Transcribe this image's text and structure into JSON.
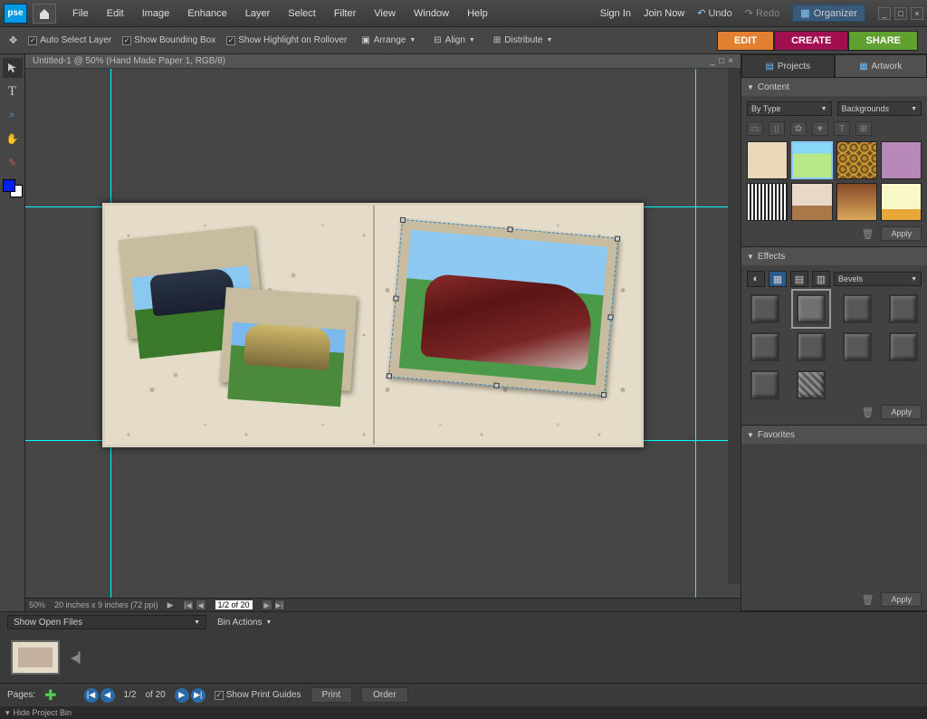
{
  "app": {
    "logo_text": "pse"
  },
  "menu": [
    "File",
    "Edit",
    "Image",
    "Enhance",
    "Layer",
    "Select",
    "Filter",
    "View",
    "Window",
    "Help"
  ],
  "top_right": {
    "sign_in": "Sign In",
    "join_now": "Join Now",
    "undo": "Undo",
    "redo": "Redo",
    "organizer": "Organizer"
  },
  "options": {
    "auto_select": "Auto Select Layer",
    "show_bbox": "Show Bounding Box",
    "show_highlight": "Show Highlight on Rollover",
    "arrange": "Arrange",
    "align": "Align",
    "distribute": "Distribute"
  },
  "modes": {
    "edit": "EDIT",
    "create": "CREATE",
    "share": "SHARE"
  },
  "doc": {
    "title": "Untitled-1 @ 50% (Hand Made Paper 1, RGB/8)",
    "zoom": "50%",
    "dims": "20 inches x 9 inches (72 ppi)",
    "page_indicator": "1/2 of 20"
  },
  "right": {
    "tab_projects": "Projects",
    "tab_artwork": "Artwork",
    "content_hdr": "Content",
    "filter_by": "By Type",
    "filter_cat": "Backgrounds",
    "apply": "Apply",
    "effects_hdr": "Effects",
    "effects_sel": "Bevels",
    "favorites_hdr": "Favorites"
  },
  "bin": {
    "show_open": "Show Open Files",
    "bin_actions": "Bin Actions",
    "pages_label": "Pages:",
    "current": "1/2",
    "of": "of 20",
    "show_print_guides": "Show Print Guides",
    "print": "Print",
    "order": "Order"
  },
  "status": {
    "hide_bin": "Hide Project Bin"
  }
}
